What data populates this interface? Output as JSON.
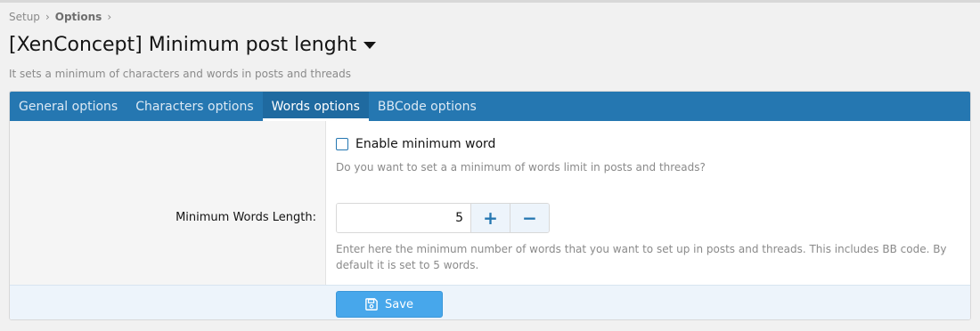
{
  "breadcrumb": {
    "items": [
      "Setup",
      "Options"
    ],
    "separator": "›"
  },
  "page": {
    "title": "[XenConcept] Minimum post lenght",
    "description": "It sets a minimum of characters and words in posts and threads"
  },
  "tabs": [
    {
      "label": "General options"
    },
    {
      "label": "Characters options"
    },
    {
      "label": "Words options",
      "active": true
    },
    {
      "label": "BBCode options"
    }
  ],
  "form": {
    "enable_checkbox_label": "Enable minimum word",
    "enable_checkbox_checked": false,
    "enable_hint": "Do you want to set a a minimum of words limit in posts and threads?",
    "min_words_label": "Minimum Words Length:",
    "min_words_value": "5",
    "plus_symbol": "+",
    "minus_symbol": "−",
    "min_words_hint": "Enter here the minimum number of words that you want to set up in posts and threads. This includes BB code. By default it is set to 5 words."
  },
  "footer": {
    "save_label": "Save"
  },
  "colors": {
    "tab_bar": "#2577b1",
    "save_button": "#47a7eb",
    "footer_bg": "#edf4fb"
  },
  "icons": {
    "save": "floppy-disk-icon",
    "title_caret": "caret-down-icon"
  }
}
